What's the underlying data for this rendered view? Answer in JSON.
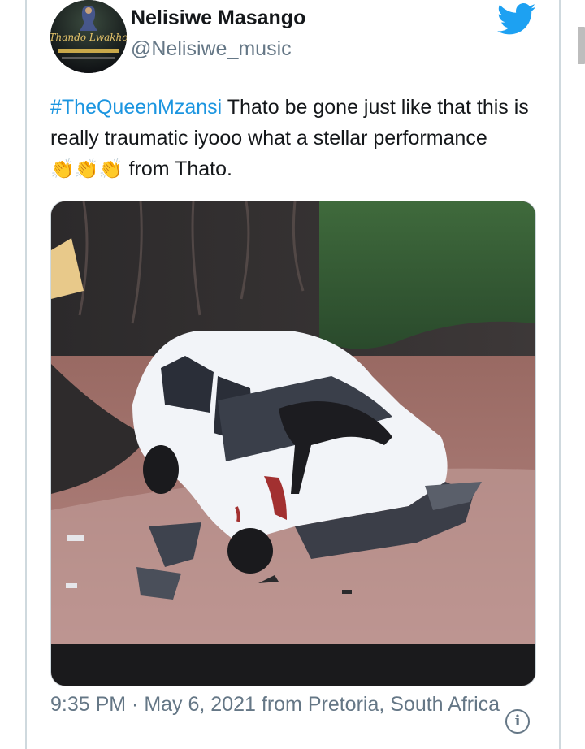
{
  "user": {
    "display_name": "Nelisiwe Masango",
    "handle": "@Nelisiwe_music",
    "avatar_text": "Thando Lwakho",
    "avatar_icon": "profile-photo"
  },
  "tweet": {
    "hashtag": "#TheQueenMzansi",
    "text_part1": " Thato be gone just like that this is really traumatic iyooo what a stellar performance ",
    "claps": "👏👏👏",
    "text_part2": " from Thato.",
    "media_icon": "photo-crashed-white-car"
  },
  "meta": {
    "time": "9:35 PM",
    "separator": " · ",
    "date": "May 6, 2021",
    "location": " from Pretoria, South Africa"
  },
  "icons": {
    "twitter": "twitter-bird-icon",
    "info": "info-icon"
  },
  "colors": {
    "brand": "#1da1f2",
    "link": "#1b95e0",
    "muted": "#657786",
    "border": "#cfd9de"
  }
}
